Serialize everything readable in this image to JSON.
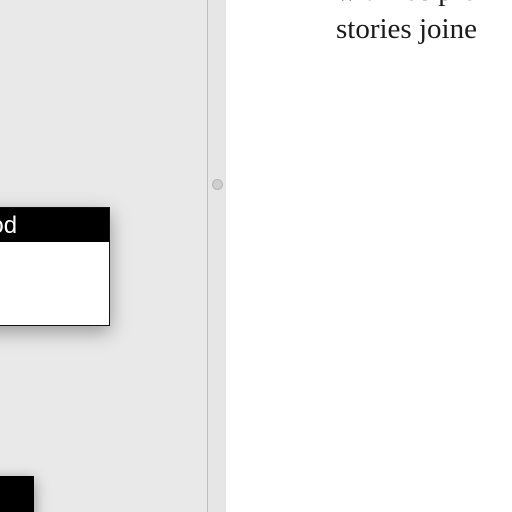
{
  "canvas": {
    "node_card": {
      "header_text": "ood"
    }
  },
  "document": {
    "lines": [
      "with recipro",
      "stories joine"
    ]
  },
  "colors": {
    "canvas_bg": "#e9e9e9",
    "node_header_bg": "#000000",
    "document_bg": "#ffffff"
  }
}
